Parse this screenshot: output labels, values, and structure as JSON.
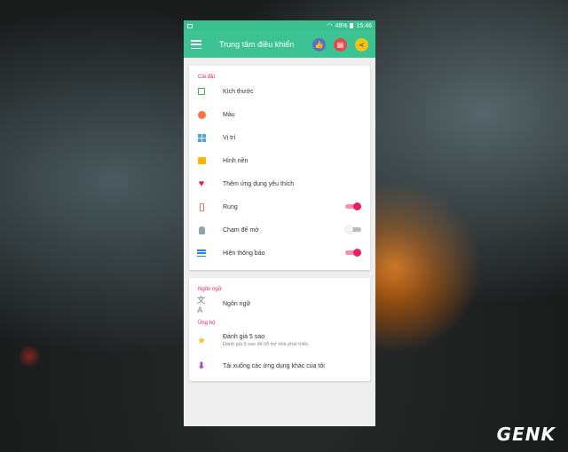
{
  "status_bar": {
    "battery": "48%",
    "time": "15:46"
  },
  "app_bar": {
    "title": "Trung tâm điều khiển"
  },
  "settings_section": {
    "title": "Cài đặt",
    "items": [
      {
        "label": "Kích thước",
        "icon": "resize-icon"
      },
      {
        "label": "Màu",
        "icon": "palette-icon"
      },
      {
        "label": "Vị trí",
        "icon": "grid-icon"
      },
      {
        "label": "Hình nền",
        "icon": "image-icon"
      },
      {
        "label": "Thêm ứng dụng yêu thích",
        "icon": "heart-icon"
      },
      {
        "label": "Rung",
        "icon": "vibrate-icon",
        "toggle": true
      },
      {
        "label": "Chạm để mở",
        "icon": "touch-icon",
        "toggle": false
      },
      {
        "label": "Hiện thông báo",
        "icon": "list-icon",
        "toggle": true
      }
    ]
  },
  "language_section": {
    "title": "Ngôn ngữ",
    "item_label": "Ngôn ngữ"
  },
  "support_section": {
    "title": "Ủng hộ",
    "rate_label": "Đánh giá 5 sao",
    "rate_sub": "Đánh giá 5 sao để hỗ trợ nhà phát triển.",
    "download_label": "Tải xuống các ứng dụng khác của tôi"
  },
  "watermark": "GENK",
  "colors": {
    "accent": "#3cc293",
    "pink": "#e91e63"
  }
}
